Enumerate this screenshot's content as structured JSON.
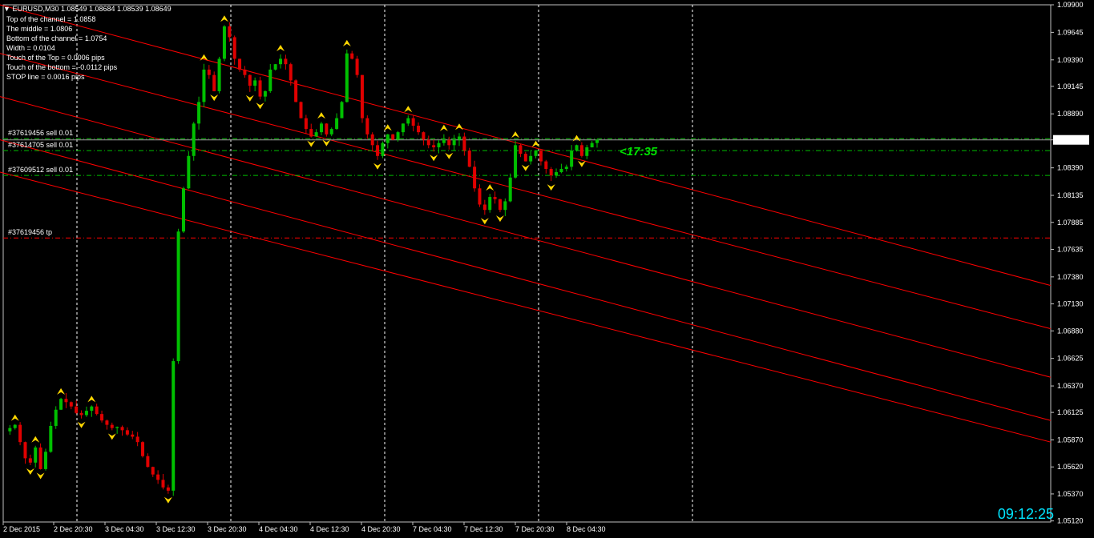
{
  "header": {
    "symbol": "EURUSD,M30",
    "ohlc": "1.08549 1.08684 1.08539 1.08649"
  },
  "info_lines": [
    "Top of the channel = 1.0858",
    "The middle = 1.0806",
    "Bottom of the channel = 1.0754",
    "Width = 0.0104",
    "Touch of the Top = 0.0006 pips",
    "Touch of the bottom = -0.0112 pips",
    "STOP line  = 0.0016 pips"
  ],
  "orders": [
    {
      "label": "#37619456 sell 0.01",
      "price": 1.0866
    },
    {
      "label": "#37614705 sell 0.01",
      "price": 1.0855
    },
    {
      "label": "#37609512 sell 0.01",
      "price": 1.0832
    },
    {
      "label": "#37619456 tp",
      "price": 1.0774
    }
  ],
  "timer": "<17:35",
  "clock": "09:12:25",
  "colors": {
    "background": "#000000",
    "bull": "#00c000",
    "bear": "#e00000",
    "channel": "#ff0000",
    "order_line": "#00c000",
    "tp_line": "#ff0000",
    "fractal": "#ffd700",
    "timer": "#00e000",
    "clock": "#00e5ff"
  },
  "chart_data": {
    "type": "candlestick",
    "title": "EURUSD,M30",
    "ylim": [
      1.0511,
      1.099
    ],
    "current_price": 1.08649,
    "y_ticks": [
      "1.09900",
      "1.09645",
      "1.09390",
      "1.09145",
      "1.08890",
      "1.08649",
      "1.08390",
      "1.08135",
      "1.07885",
      "1.07635",
      "1.07380",
      "1.07130",
      "1.06880",
      "1.06625",
      "1.06370",
      "1.06125",
      "1.05870",
      "1.05620",
      "1.05370",
      "1.05120"
    ],
    "x_ticks": [
      "2 Dec 2015",
      "2 Dec 20:30",
      "3 Dec 04:30",
      "3 Dec 12:30",
      "3 Dec 20:30",
      "4 Dec 04:30",
      "4 Dec 12:30",
      "4 Dec 20:30",
      "7 Dec 04:30",
      "7 Dec 12:30",
      "7 Dec 20:30",
      "8 Dec 04:30"
    ],
    "close_path": [
      1.0595,
      1.0598,
      1.0601,
      1.0585,
      1.057,
      1.0566,
      1.058,
      1.056,
      1.0576,
      1.06,
      1.0615,
      1.0625,
      1.0622,
      1.0618,
      1.0612,
      1.061,
      1.0614,
      1.0618,
      1.0611,
      1.0605,
      1.0601,
      1.0598,
      1.0599,
      1.0596,
      1.0592,
      1.059,
      1.0585,
      1.0572,
      1.0562,
      1.0555,
      1.055,
      1.0543,
      1.054,
      1.066,
      1.078,
      1.082,
      1.085,
      1.088,
      1.09,
      1.093,
      1.0925,
      1.091,
      1.094,
      1.097,
      1.096,
      1.094,
      1.093,
      1.0925,
      1.0915,
      1.092,
      1.0905,
      1.091,
      1.093,
      1.0935,
      1.094,
      1.0935,
      1.092,
      1.09,
      1.0885,
      1.0875,
      1.0868,
      1.0872,
      1.088,
      1.087,
      1.0875,
      1.0885,
      1.09,
      1.0945,
      1.094,
      1.0925,
      1.0885,
      1.087,
      1.086,
      1.085,
      1.0862,
      1.087,
      1.0865,
      1.0872,
      1.088,
      1.0885,
      1.0878,
      1.0872,
      1.0865,
      1.086,
      1.0858,
      1.0862,
      1.0865,
      1.086,
      1.0865,
      1.0868,
      1.0855,
      1.084,
      1.082,
      1.0805,
      1.08,
      1.0812,
      1.081,
      1.08,
      1.0808,
      1.083,
      1.086,
      1.0852,
      1.0845,
      1.085,
      1.0855,
      1.0845,
      1.0838,
      1.0832,
      1.0835,
      1.0838,
      1.084,
      1.0855,
      1.086,
      1.085,
      1.0858,
      1.0862,
      1.0865
    ],
    "channel_lines": [
      {
        "start": [
          0,
          1.099
        ],
        "end": [
          1365,
          1.073
        ]
      },
      {
        "start": [
          0,
          1.0945
        ],
        "end": [
          1365,
          1.069
        ]
      },
      {
        "start": [
          0,
          1.0905
        ],
        "end": [
          1365,
          1.0645
        ]
      },
      {
        "start": [
          0,
          1.0865
        ],
        "end": [
          1365,
          1.0605
        ]
      },
      {
        "start": [
          0,
          1.0835
        ],
        "end": [
          1365,
          1.0585
        ]
      }
    ]
  }
}
